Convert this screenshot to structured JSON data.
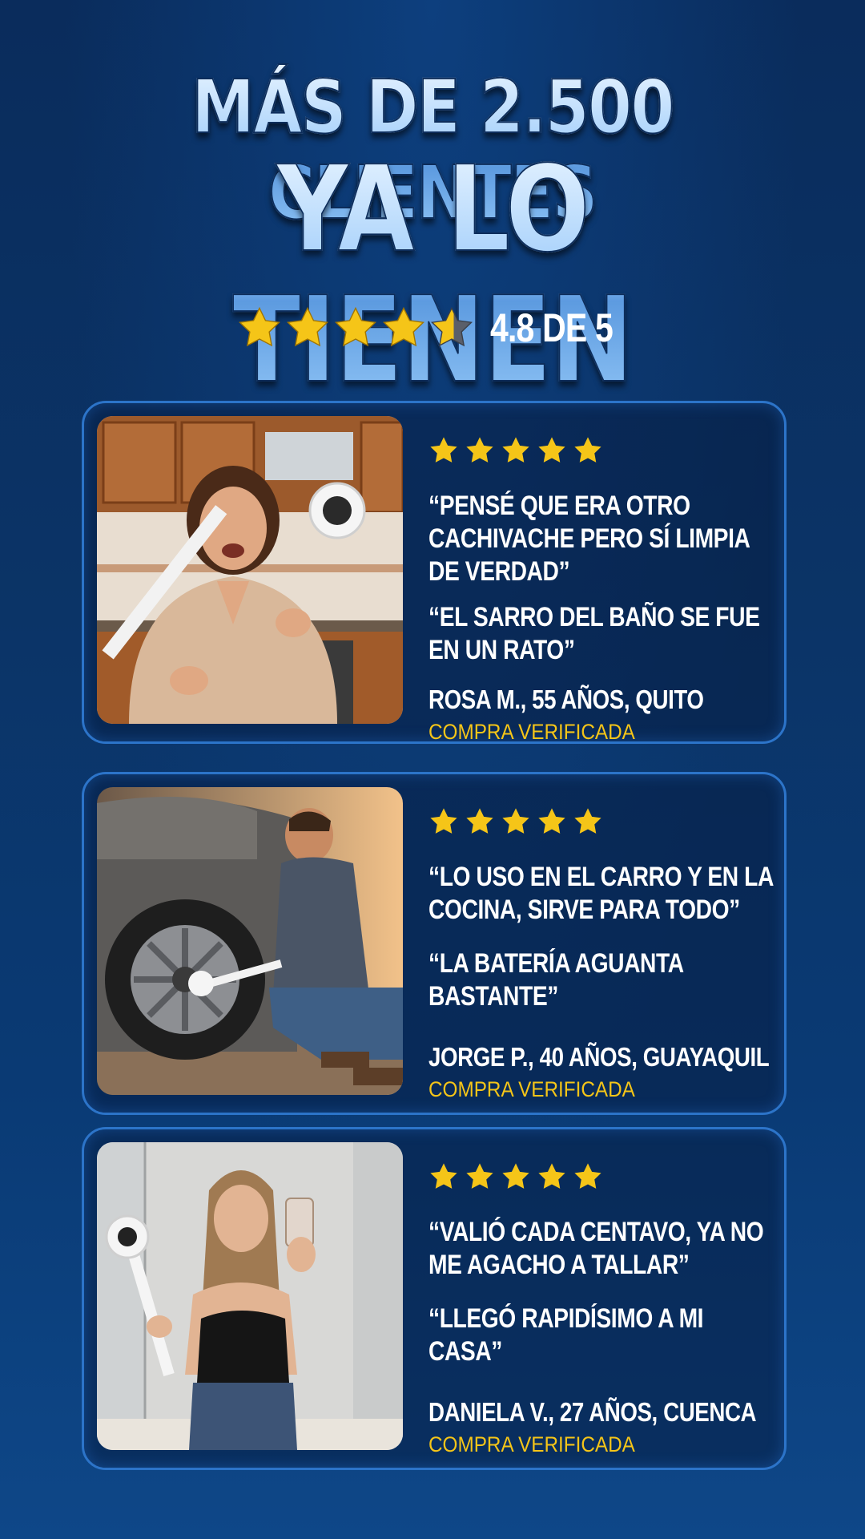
{
  "headline": {
    "line1": "MÁS DE 2.500 CLIENTES",
    "line2": "YA LO TIENEN"
  },
  "rating": {
    "value": 4.8,
    "max": 5,
    "text": "4.8 DE 5"
  },
  "colors": {
    "star": "#f5c518",
    "accent_border": "#2c74c9",
    "verified": "#f5c518"
  },
  "reviews": [
    {
      "stars": 5,
      "quote1": "“PENSÉ QUE ERA OTRO CACHIVACHE PERO SÍ LIMPIA DE VERDAD”",
      "quote2": "“EL SARRO DEL BAÑO SE FUE EN UN RATO”",
      "author": "ROSA M., 55 AÑOS, QUITO",
      "verified": "COMPRA VERIFICADA"
    },
    {
      "stars": 5,
      "quote1": "“LO USO EN EL CARRO Y EN LA COCINA, SIRVE PARA TODO”",
      "quote2": "“LA BATERÍA AGUANTA BASTANTE”",
      "author": "JORGE P., 40 AÑOS, GUAYAQUIL",
      "verified": "COMPRA VERIFICADA"
    },
    {
      "stars": 5,
      "quote1": "“VALIÓ CADA CENTAVO, YA NO ME AGACHO A TALLAR”",
      "quote2": "“LLEGÓ RAPIDÍSIMO A MI CASA”",
      "author": "DANIELA V., 27 AÑOS, CUENCA",
      "verified": "COMPRA VERIFICADA"
    }
  ]
}
